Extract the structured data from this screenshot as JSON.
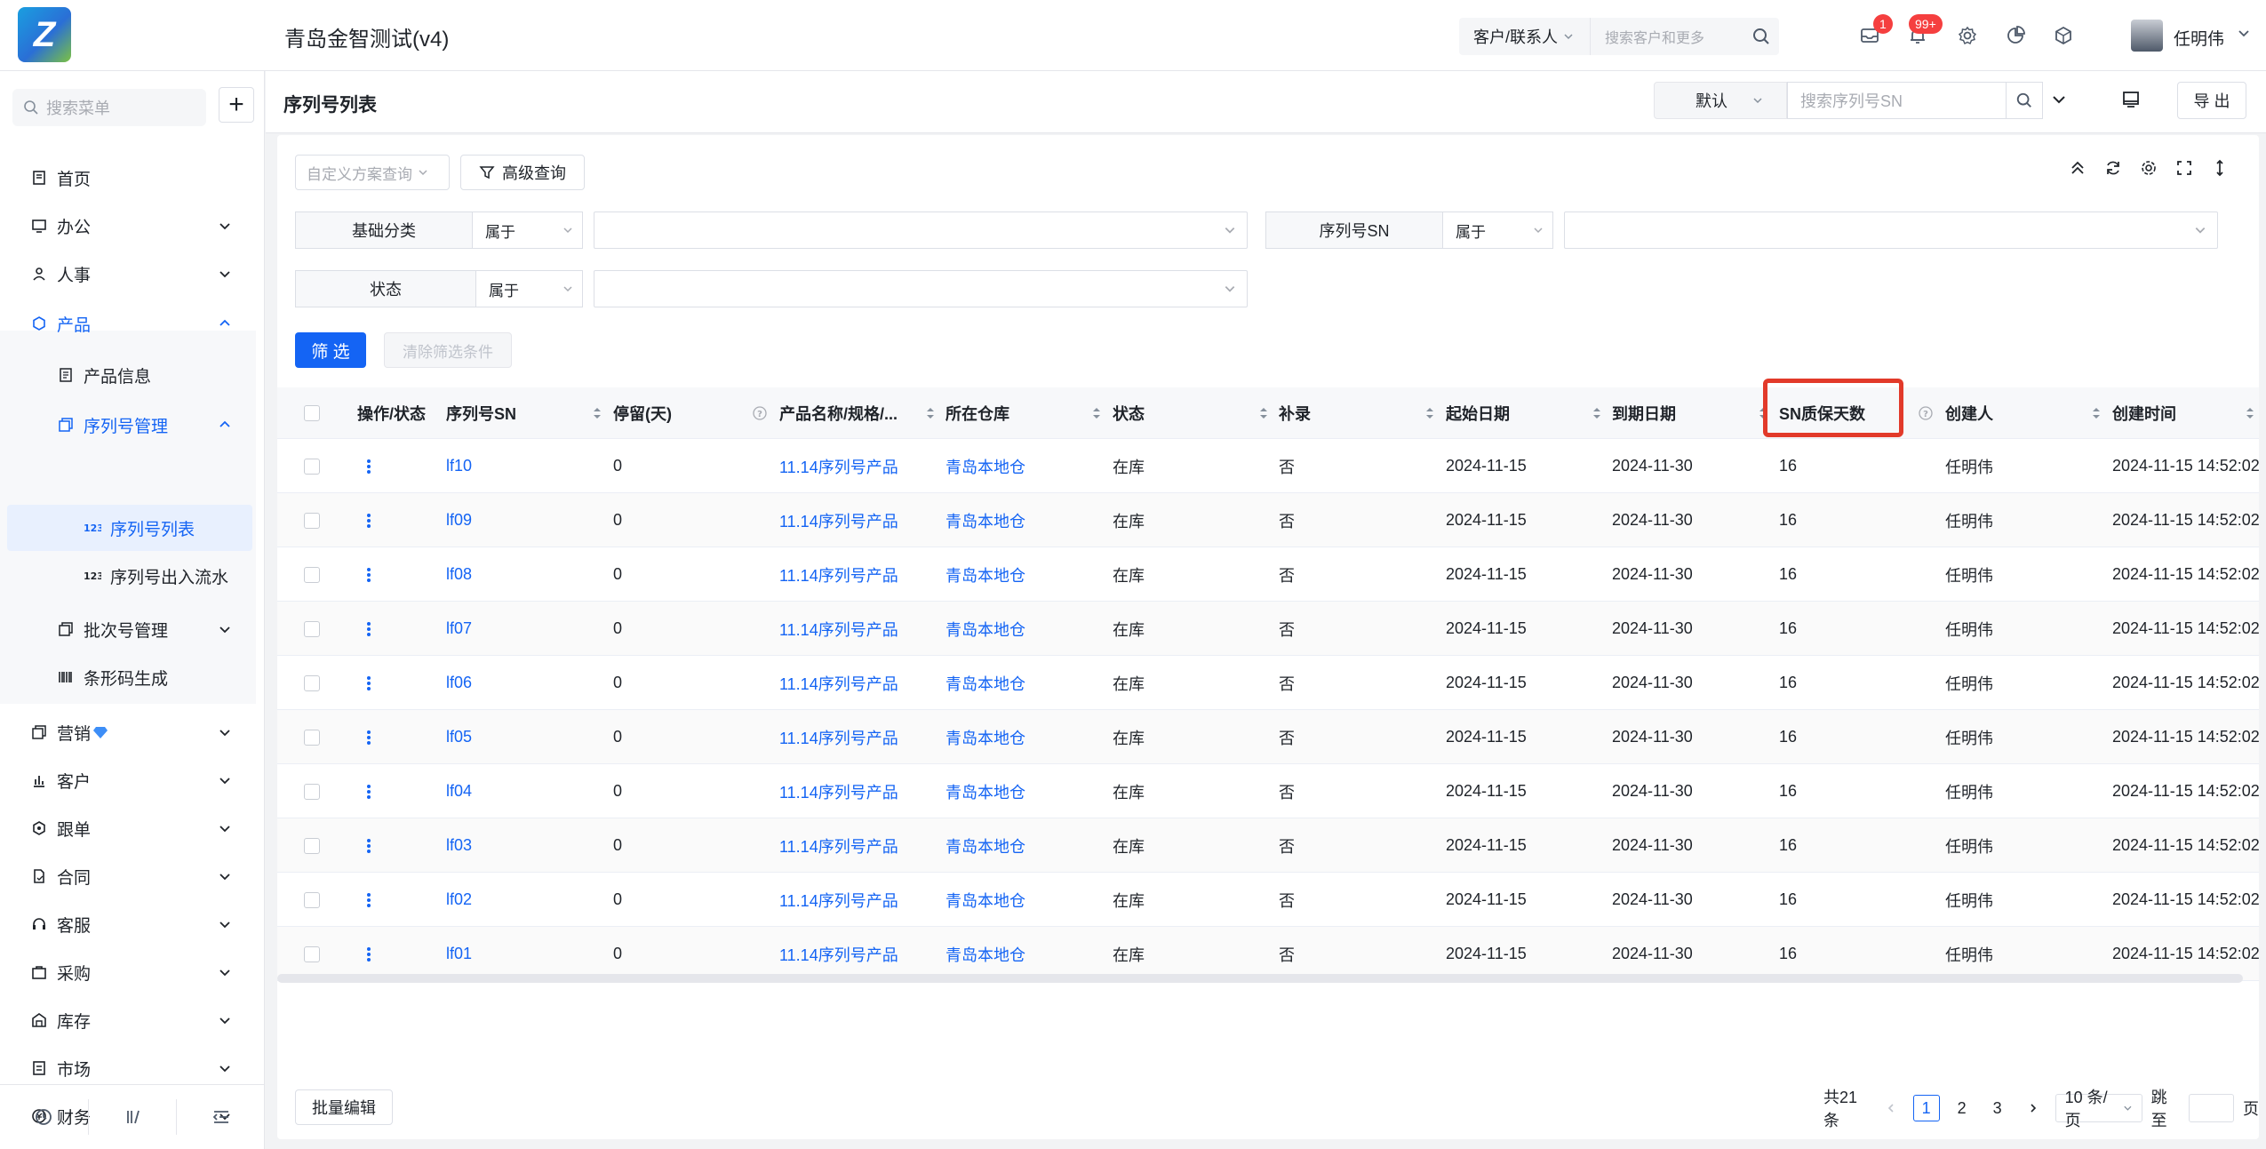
{
  "app": {
    "logo_text": "Z",
    "title": "青岛金智测试(v4)"
  },
  "topbar": {
    "search_category": "客户/联系人",
    "search_placeholder": "搜索客户和更多",
    "mail_badge": "1",
    "bell_badge": "99+",
    "user_name": "任明伟"
  },
  "sidebar": {
    "search_placeholder": "搜索菜单",
    "add_label": "+",
    "items": [
      {
        "label": "首页"
      },
      {
        "label": "办公"
      },
      {
        "label": "人事"
      },
      {
        "label": "产品"
      },
      {
        "label": "产品信息"
      },
      {
        "label": "序列号管理"
      },
      {
        "label": "序列号列表"
      },
      {
        "label": "序列号出入流水"
      },
      {
        "label": "批次号管理"
      },
      {
        "label": "条形码生成"
      },
      {
        "label": "营销"
      },
      {
        "label": "客户"
      },
      {
        "label": "跟单"
      },
      {
        "label": "合同"
      },
      {
        "label": "客服"
      },
      {
        "label": "采购"
      },
      {
        "label": "库存"
      },
      {
        "label": "市场"
      },
      {
        "label": "财务"
      }
    ],
    "footer_icons": [
      "history-icon",
      "percent-icon",
      "collapse-menu-icon"
    ]
  },
  "page": {
    "title": "序列号列表",
    "view_select": "默认",
    "sn_search_placeholder": "搜索序列号SN",
    "export_label": "导 出"
  },
  "filters": {
    "scheme_placeholder": "自定义方案查询",
    "advanced_label": "高级查询",
    "rows": [
      {
        "label": "基础分类",
        "op": "属于"
      },
      {
        "label": "序列号SN",
        "op": "属于"
      },
      {
        "label": "状态",
        "op": "属于"
      }
    ],
    "filter_btn": "筛 选",
    "clear_btn": "清除筛选条件"
  },
  "table": {
    "columns": [
      "操作/状态",
      "序列号SN",
      "停留(天)",
      "产品名称/规格/...",
      "所在仓库",
      "状态",
      "补录",
      "起始日期",
      "到期日期",
      "SN质保天数",
      "创建人",
      "创建时间"
    ],
    "rows": [
      {
        "sn": "lf10",
        "stay": "0",
        "product": "11.14序列号产品",
        "warehouse": "青岛本地仓",
        "status": "在库",
        "supplement": "否",
        "start": "2024-11-15",
        "end": "2024-11-30",
        "warranty": "16",
        "creator": "任明伟",
        "created": "2024-11-15 14:52:02"
      },
      {
        "sn": "lf09",
        "stay": "0",
        "product": "11.14序列号产品",
        "warehouse": "青岛本地仓",
        "status": "在库",
        "supplement": "否",
        "start": "2024-11-15",
        "end": "2024-11-30",
        "warranty": "16",
        "creator": "任明伟",
        "created": "2024-11-15 14:52:02"
      },
      {
        "sn": "lf08",
        "stay": "0",
        "product": "11.14序列号产品",
        "warehouse": "青岛本地仓",
        "status": "在库",
        "supplement": "否",
        "start": "2024-11-15",
        "end": "2024-11-30",
        "warranty": "16",
        "creator": "任明伟",
        "created": "2024-11-15 14:52:02"
      },
      {
        "sn": "lf07",
        "stay": "0",
        "product": "11.14序列号产品",
        "warehouse": "青岛本地仓",
        "status": "在库",
        "supplement": "否",
        "start": "2024-11-15",
        "end": "2024-11-30",
        "warranty": "16",
        "creator": "任明伟",
        "created": "2024-11-15 14:52:02"
      },
      {
        "sn": "lf06",
        "stay": "0",
        "product": "11.14序列号产品",
        "warehouse": "青岛本地仓",
        "status": "在库",
        "supplement": "否",
        "start": "2024-11-15",
        "end": "2024-11-30",
        "warranty": "16",
        "creator": "任明伟",
        "created": "2024-11-15 14:52:02"
      },
      {
        "sn": "lf05",
        "stay": "0",
        "product": "11.14序列号产品",
        "warehouse": "青岛本地仓",
        "status": "在库",
        "supplement": "否",
        "start": "2024-11-15",
        "end": "2024-11-30",
        "warranty": "16",
        "creator": "任明伟",
        "created": "2024-11-15 14:52:02"
      },
      {
        "sn": "lf04",
        "stay": "0",
        "product": "11.14序列号产品",
        "warehouse": "青岛本地仓",
        "status": "在库",
        "supplement": "否",
        "start": "2024-11-15",
        "end": "2024-11-30",
        "warranty": "16",
        "creator": "任明伟",
        "created": "2024-11-15 14:52:02"
      },
      {
        "sn": "lf03",
        "stay": "0",
        "product": "11.14序列号产品",
        "warehouse": "青岛本地仓",
        "status": "在库",
        "supplement": "否",
        "start": "2024-11-15",
        "end": "2024-11-30",
        "warranty": "16",
        "creator": "任明伟",
        "created": "2024-11-15 14:52:02"
      },
      {
        "sn": "lf02",
        "stay": "0",
        "product": "11.14序列号产品",
        "warehouse": "青岛本地仓",
        "status": "在库",
        "supplement": "否",
        "start": "2024-11-15",
        "end": "2024-11-30",
        "warranty": "16",
        "creator": "任明伟",
        "created": "2024-11-15 14:52:02"
      },
      {
        "sn": "lf01",
        "stay": "0",
        "product": "11.14序列号产品",
        "warehouse": "青岛本地仓",
        "status": "在库",
        "supplement": "否",
        "start": "2024-11-15",
        "end": "2024-11-30",
        "warranty": "16",
        "creator": "任明伟",
        "created": "2024-11-15 14:52:02"
      }
    ]
  },
  "footer": {
    "batch_edit": "批量编辑",
    "total": "共21条",
    "pages": [
      "1",
      "2",
      "3"
    ],
    "current_page": "1",
    "page_size": "10 条/页",
    "jump_label": "跳至",
    "page_suffix": "页"
  },
  "colors": {
    "accent": "#1464f4",
    "highlight": "#e23a2a",
    "badge": "#f53f3f"
  }
}
